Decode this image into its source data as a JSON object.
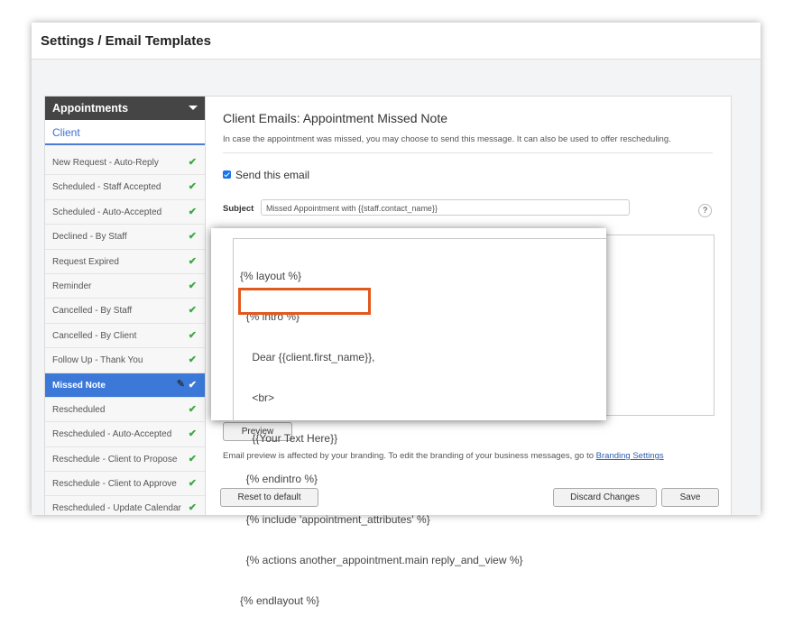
{
  "page_title": "Settings / Email Templates",
  "sidebar": {
    "header": "Appointments",
    "sub_tab": "Client",
    "items": [
      {
        "label": "New Request - Auto-Reply",
        "check": "✔"
      },
      {
        "label": "Scheduled - Staff Accepted",
        "check": "✔"
      },
      {
        "label": "Scheduled - Auto-Accepted",
        "check": "✔"
      },
      {
        "label": "Declined - By Staff",
        "check": "✔"
      },
      {
        "label": "Request Expired",
        "check": "✔"
      },
      {
        "label": "Reminder",
        "check": "✔"
      },
      {
        "label": "Cancelled - By Staff",
        "check": "✔"
      },
      {
        "label": "Cancelled - By Client",
        "check": "✔"
      },
      {
        "label": "Follow Up - Thank You",
        "check": "✔"
      },
      {
        "label": "Missed Note",
        "check": "✔",
        "active": true
      },
      {
        "label": "Rescheduled",
        "check": "✔"
      },
      {
        "label": "Rescheduled - Auto-Accepted",
        "check": "✔"
      },
      {
        "label": "Reschedule - Client to Propose",
        "check": "✔"
      },
      {
        "label": "Reschedule - Client to Approve",
        "check": "✔"
      },
      {
        "label": "Rescheduled - Update Calendar",
        "check": "✔"
      }
    ]
  },
  "main": {
    "title": "Client Emails: Appointment Missed Note",
    "description": "In case the appointment was missed, you may choose to send this message. It can also be used to offer rescheduling.",
    "send_label": "Send this email",
    "send_checked": true,
    "subject_label": "Subject",
    "subject_value": "Missed Appointment with {{staff.contact_name}}",
    "help": "?",
    "preview_label": "Preview",
    "note_text": "Email preview is affected by your branding. To edit the branding of your business messages, go to ",
    "note_link": "Branding Settings",
    "reset_label": "Reset to default",
    "discard_label": "Discard Changes",
    "save_label": "Save"
  },
  "editor": {
    "lines": [
      "{% layout %}",
      "  {% intro %}",
      "    Dear {{client.first_name}},",
      "    <br>",
      "    {{Your Text Here}}",
      "  {% endintro %}",
      "  {% include 'appointment_attributes' %}",
      "  {% actions another_appointment.main reply_and_view %}",
      "{% endlayout %}"
    ]
  },
  "colors": {
    "accent": "#3c78d8",
    "highlight": "#e2581e",
    "check": "#3daa3d"
  }
}
